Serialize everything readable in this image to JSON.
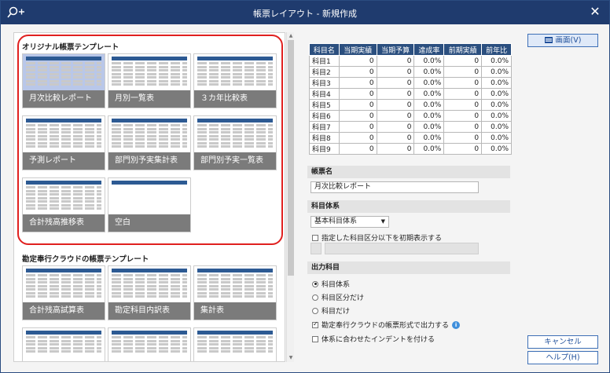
{
  "window": {
    "title": "帳票レイアウト - 新規作成"
  },
  "left": {
    "section1_title": "オリジナル帳票テンプレート",
    "section2_title": "勘定奉行クラウドの帳票テンプレート",
    "templates1": [
      {
        "label": "月次比較レポート"
      },
      {
        "label": "月別一覧表"
      },
      {
        "label": "３カ年比較表"
      },
      {
        "label": "予測レポート"
      },
      {
        "label": "部門別予実集計表"
      },
      {
        "label": "部門別予実一覧表"
      },
      {
        "label": "合計残高推移表"
      },
      {
        "label": "空白"
      }
    ],
    "templates2": [
      {
        "label": "合計残高試算表"
      },
      {
        "label": "勘定科目内訳表"
      },
      {
        "label": "集計表"
      }
    ]
  },
  "preview": {
    "headers": [
      "科目名",
      "当期実績",
      "当期予算",
      "達成率",
      "前期実績",
      "前年比"
    ],
    "rows": [
      [
        "科目1",
        "0",
        "0",
        "0.0%",
        "0",
        "0.0%"
      ],
      [
        "科目2",
        "0",
        "0",
        "0.0%",
        "0",
        "0.0%"
      ],
      [
        "科目3",
        "0",
        "0",
        "0.0%",
        "0",
        "0.0%"
      ],
      [
        "科目4",
        "0",
        "0",
        "0.0%",
        "0",
        "0.0%"
      ],
      [
        "科目5",
        "0",
        "0",
        "0.0%",
        "0",
        "0.0%"
      ],
      [
        "科目6",
        "0",
        "0",
        "0.0%",
        "0",
        "0.0%"
      ],
      [
        "科目7",
        "0",
        "0",
        "0.0%",
        "0",
        "0.0%"
      ],
      [
        "科目8",
        "0",
        "0",
        "0.0%",
        "0",
        "0.0%"
      ],
      [
        "科目9",
        "0",
        "0",
        "0.0%",
        "0",
        "0.0%"
      ]
    ]
  },
  "form": {
    "report_name_label": "帳票名",
    "report_name_value": "月次比較レポート",
    "account_system_label": "科目体系",
    "account_system_value": "基本科目体系",
    "initial_display_label": "指定した科目区分以下を初期表示する",
    "output_label": "出力科目",
    "radio_options": [
      "科目体系",
      "科目区分だけ",
      "科目だけ"
    ],
    "output_format_label": "勘定奉行クラウドの帳票形式で出力する",
    "indent_label": "体系に合わせたインデントを付ける"
  },
  "buttons": {
    "screen": "画面(V)",
    "cancel": "キャンセル",
    "help": "ヘルプ(H)"
  },
  "colors": {
    "titlebar": "#1f3b6e",
    "table_header": "#2b4f7f",
    "highlight": "#e0201f",
    "caption_bg": "#7b7b7b"
  }
}
